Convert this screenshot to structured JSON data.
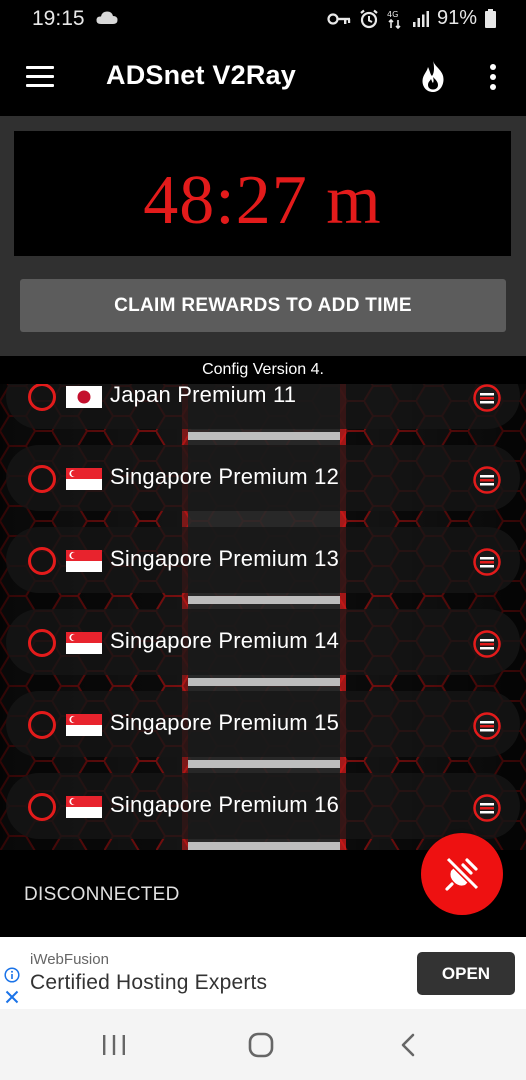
{
  "status_bar": {
    "time": "19:15",
    "network": "4G",
    "battery": "91%",
    "icons": [
      "cloud-icon",
      "vpn-key-icon",
      "alarm-icon",
      "data-arrows-icon",
      "signal-icon",
      "battery-icon"
    ]
  },
  "toolbar": {
    "title": "ADSnet V2Ray",
    "icons": [
      "menu-icon",
      "fire-icon",
      "more-vert-icon"
    ]
  },
  "timer": {
    "value": "48:27 m",
    "color": "#e31b1b"
  },
  "claim_button": {
    "label": "CLAIM REWARDS TO ADD TIME"
  },
  "config": {
    "label": "Config Version 4."
  },
  "servers": [
    {
      "name": "Japan Premium 11",
      "flag": "japan"
    },
    {
      "name": "Singapore Premium 12",
      "flag": "singapore"
    },
    {
      "name": "Singapore Premium 13",
      "flag": "singapore"
    },
    {
      "name": "Singapore Premium 14",
      "flag": "singapore"
    },
    {
      "name": "Singapore Premium 15",
      "flag": "singapore"
    },
    {
      "name": "Singapore Premium 16",
      "flag": "singapore"
    }
  ],
  "connection": {
    "status": "DISCONNECTED"
  },
  "ad": {
    "brand": "iWebFusion",
    "headline": "Certified Hosting Experts",
    "cta": "OPEN"
  },
  "colors": {
    "accent": "#e31b1b",
    "fab": "#ee1111",
    "panel": "#303030",
    "button": "#5c5c5c"
  }
}
